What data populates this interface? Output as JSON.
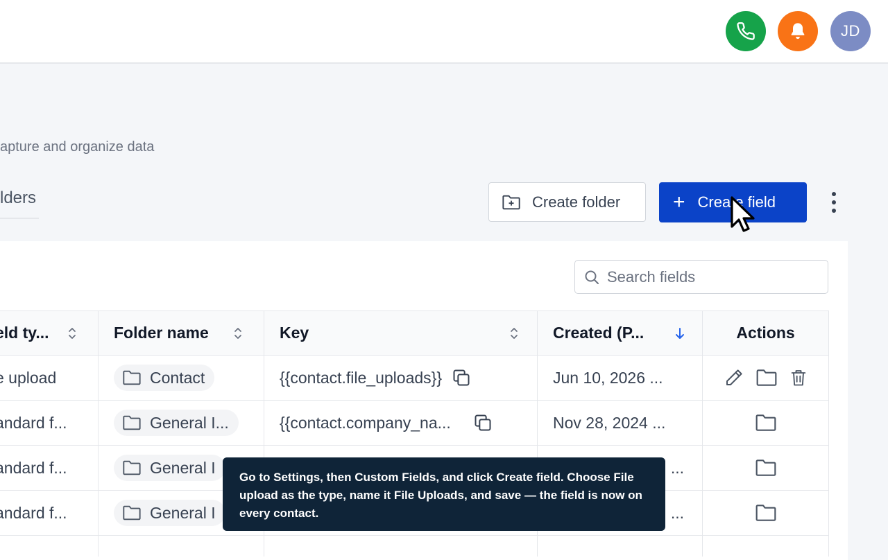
{
  "header": {
    "avatar_initials": "JD",
    "phone_color": "#16a34a",
    "bell_color": "#f97316",
    "avatar_color": "#7c8cc4"
  },
  "page": {
    "subtitle": "apture and organize data",
    "tab_label": "lders"
  },
  "toolbar": {
    "create_folder_label": "Create folder",
    "create_field_label": "Create field",
    "accent_color": "#0b43c8"
  },
  "search": {
    "placeholder": "Search fields"
  },
  "table": {
    "columns": [
      "eld ty...",
      "Folder name",
      "Key",
      "Created (P...",
      "Actions"
    ],
    "rows": [
      {
        "type": "e upload",
        "folder": "Contact",
        "key": "{{contact.file_uploads}}",
        "created": "Jun 10, 2026 ..."
      },
      {
        "type": "andard f...",
        "folder": "General I...",
        "key": "{{contact.company_na...",
        "created": "Nov 28, 2024 ..."
      },
      {
        "type": "andard f...",
        "folder": "General I",
        "key": "",
        "created": "..."
      },
      {
        "type": "andard f...",
        "folder": "General I",
        "key": "",
        "created": "..."
      }
    ]
  },
  "tooltip": {
    "text": "Go to Settings, then Custom Fields, and click Create field. Choose File upload as the type, name it File Uploads, and save — the field is now on every contact."
  }
}
